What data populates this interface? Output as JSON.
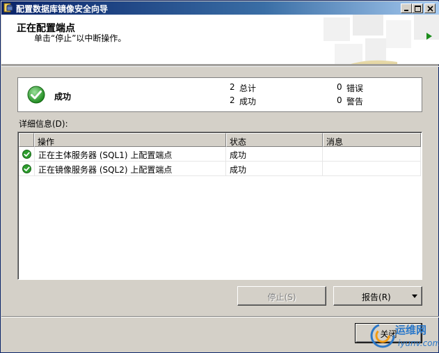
{
  "window": {
    "title": "配置数据库镜像安全向导"
  },
  "header": {
    "title": "正在配置端点",
    "subtitle": "单击“停止”以中断操作。"
  },
  "summary": {
    "status": "成功",
    "total_count": "2",
    "total_label": "总计",
    "success_count": "2",
    "success_label": "成功",
    "error_count": "0",
    "error_label": "错误",
    "warning_count": "0",
    "warning_label": "警告"
  },
  "details": {
    "label": "详细信息(D):",
    "columns": [
      "操作",
      "状态",
      "消息"
    ],
    "rows": [
      {
        "action": "正在主体服务器 (SQL1) 上配置端点",
        "status": "成功",
        "message": ""
      },
      {
        "action": "正在镜像服务器 (SQL2) 上配置端点",
        "status": "成功",
        "message": ""
      }
    ]
  },
  "buttons": {
    "stop_label": "停止",
    "stop_key": "(S)",
    "report_label": "报告",
    "report_key": "(R)",
    "close_label": "关闭"
  },
  "watermark": {
    "brand": "运维网",
    "url": "iyunv.com"
  },
  "colors": {
    "title_bar": "#0a246a",
    "success_green": "#2e9e2e",
    "face": "#d4d0c8"
  }
}
